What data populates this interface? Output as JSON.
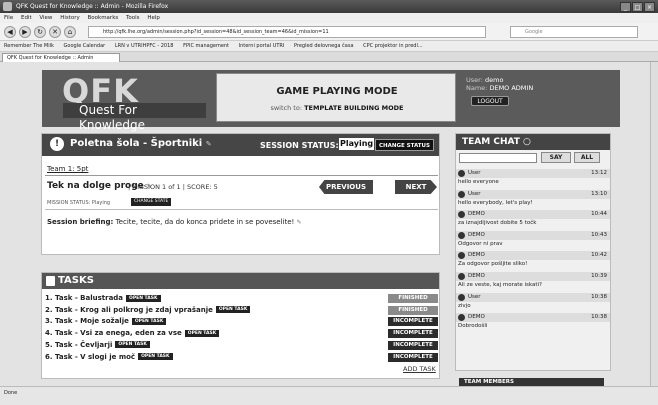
{
  "browser": {
    "window_title": "QFK Quest for Knowledge :: Admin - Mozilla Firefox",
    "menu": [
      "File",
      "Edit",
      "View",
      "History",
      "Bookmarks",
      "Tools",
      "Help"
    ],
    "url": "http://qfk.lhe.org/admin/session.php?id_session=48&id_session_team=46&id_mission=11",
    "search_placeholder": "Google",
    "bookmarks": [
      "Remember The Milk",
      "Google Calendar",
      "LRN v UTRIHPFC - 2018",
      "FPIC management",
      "Interni portal UTRI",
      "Pregled delovnega časa",
      "CPC projektor in predl..."
    ],
    "tab_title": "QFK Quest for Knowledge :: Admin",
    "status": "Done"
  },
  "header": {
    "logo": "QFK",
    "logo_sub": "Quest For Knowledge",
    "mode_title": "GAME PLAYING MODE",
    "mode_switch_prefix": "switch to:",
    "mode_switch_target": "TEMPLATE BUILDING MODE",
    "user_label": "User:",
    "user_value": "demo",
    "name_label": "Name:",
    "name_value": "DEMO ADMIN",
    "logout": "LOGOUT"
  },
  "session": {
    "title": "Poletna šola - Športniki",
    "status_label": "SESSION STATUS:",
    "status_value": "Playing",
    "change_status": "CHANGE STATUS",
    "team_tab": "Team 1:  5pt",
    "task_name": "Tek na dolge proge",
    "mission_text": "MISSION 1 of 1",
    "score_text": "SCORE: 5",
    "prev": "PREVIOUS",
    "next": "NEXT",
    "mission_status": "MISSION STATUS: Playing",
    "change_status_small": "CHANGE STATE",
    "briefing_label": "Session briefing:",
    "briefing_text": "Tecite, tecite, da do konca pridete in se poveselite!"
  },
  "tasks": {
    "title": "TASKS",
    "open_task_label": "OPEN TASK",
    "items": [
      {
        "label": "1. Task - Balustrada",
        "status": "FINISHED"
      },
      {
        "label": "2. Task - Krog ali polkrog je zdaj vprašanje",
        "status": "FINISHED"
      },
      {
        "label": "3. Task - Moje sožalje",
        "status": "INCOMPLETE"
      },
      {
        "label": "4. Task - Vsi za enega, eden za vse",
        "status": "INCOMPLETE"
      },
      {
        "label": "5. Task - Čevljarji",
        "status": "INCOMPLETE"
      },
      {
        "label": "6. Task - V slogi je moč",
        "status": "INCOMPLETE"
      }
    ],
    "add_task": "ADD TASK"
  },
  "chat": {
    "title": "TEAM CHAT",
    "say": "SAY",
    "all": "ALL",
    "messages": [
      {
        "user": "User",
        "time": "13:12",
        "text": "hello everyone"
      },
      {
        "user": "User",
        "time": "13:10",
        "text": "hello everybody, let's play!"
      },
      {
        "user": "DEMO",
        "time": "10:44",
        "text": "za iznajdljivost dobite 5 točk"
      },
      {
        "user": "DEMO",
        "time": "10:43",
        "text": "Odgovor ni prav"
      },
      {
        "user": "DEMO",
        "time": "10:42",
        "text": "Za odgovor pošljite sliko!"
      },
      {
        "user": "DEMO",
        "time": "10:39",
        "text": "Ali ze veste, kaj morate iskati?"
      },
      {
        "user": "User",
        "time": "10:38",
        "text": "zivjo"
      },
      {
        "user": "DEMO",
        "time": "10:38",
        "text": "Dobrodošli"
      }
    ]
  },
  "members": {
    "title": "TEAM MEMBERS"
  },
  "colors": {
    "finished": "#8a8a8a",
    "incomplete": "#2b2b2b",
    "header": "#5b5b5b"
  }
}
